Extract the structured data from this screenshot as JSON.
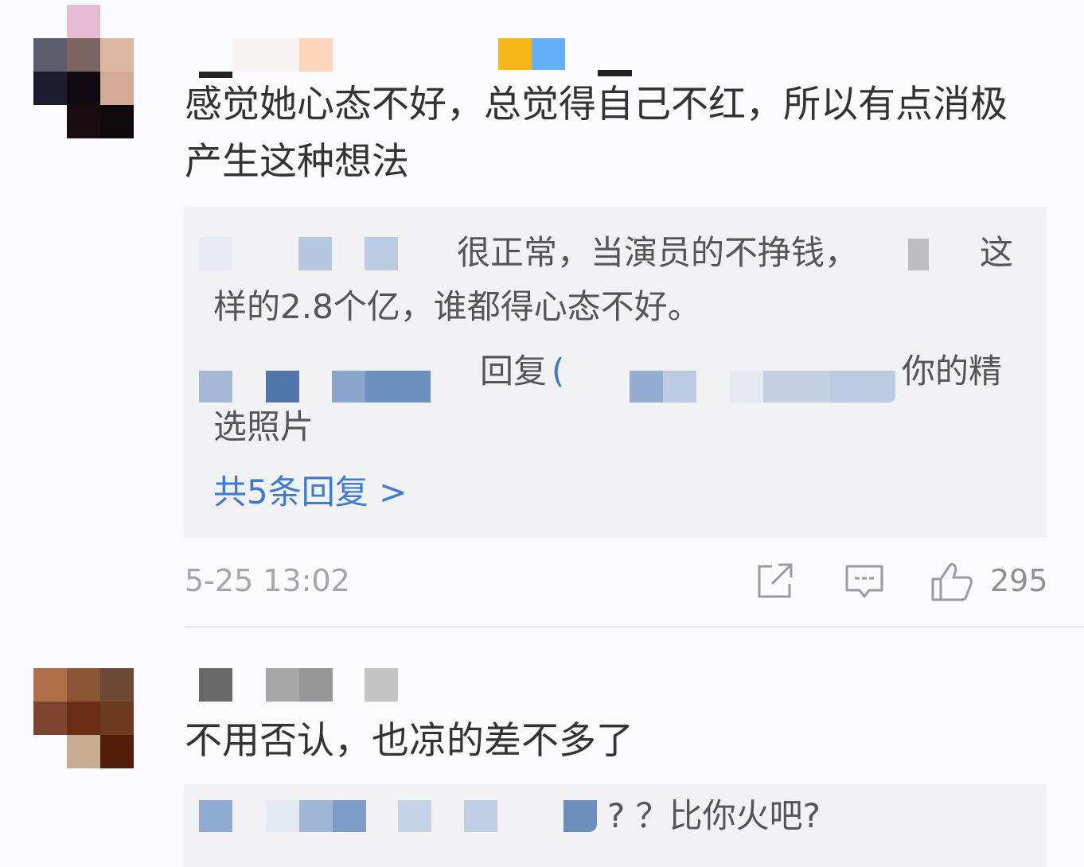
{
  "comments": [
    {
      "text": "感觉她心态不好，总觉得自己不红，所以有点消极产生这种想法",
      "reply_box": {
        "reply_part1": "很正常，当演员的不挣钱，",
        "reply_part2": "这",
        "reply_part3": "样的2.8个亿，谁都得心态不好。",
        "reply2_mid": "回复",
        "reply2_paren": "(",
        "reply2_end": "你的精",
        "reply2_cont": "选照片",
        "more_link": "共5条回复 >"
      },
      "time": "5-25 13:02",
      "like_count": "295",
      "icons": {
        "share": "share-icon",
        "comment": "comment-icon",
        "like": "thumbs-up-icon"
      }
    },
    {
      "text": "不用否认，也凉的差不多了",
      "reply_preview": "? ？比你火吧?"
    }
  ],
  "colors": {
    "link": "#3d7bd2",
    "meta": "#a5a5ad",
    "reply_bg": "#f2f2f5"
  }
}
